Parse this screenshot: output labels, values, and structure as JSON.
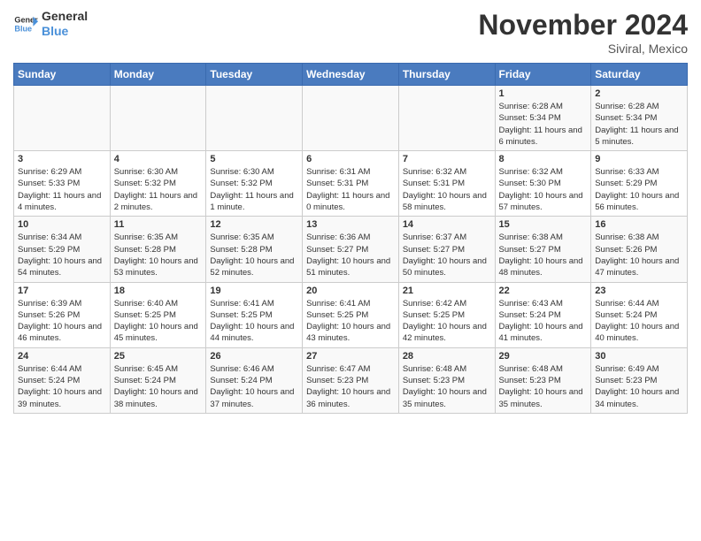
{
  "logo": {
    "line1": "General",
    "line2": "Blue"
  },
  "title": "November 2024",
  "location": "Siviral, Mexico",
  "weekdays": [
    "Sunday",
    "Monday",
    "Tuesday",
    "Wednesday",
    "Thursday",
    "Friday",
    "Saturday"
  ],
  "weeks": [
    [
      {
        "day": "",
        "info": ""
      },
      {
        "day": "",
        "info": ""
      },
      {
        "day": "",
        "info": ""
      },
      {
        "day": "",
        "info": ""
      },
      {
        "day": "",
        "info": ""
      },
      {
        "day": "1",
        "info": "Sunrise: 6:28 AM\nSunset: 5:34 PM\nDaylight: 11 hours and 6 minutes."
      },
      {
        "day": "2",
        "info": "Sunrise: 6:28 AM\nSunset: 5:34 PM\nDaylight: 11 hours and 5 minutes."
      }
    ],
    [
      {
        "day": "3",
        "info": "Sunrise: 6:29 AM\nSunset: 5:33 PM\nDaylight: 11 hours and 4 minutes."
      },
      {
        "day": "4",
        "info": "Sunrise: 6:30 AM\nSunset: 5:32 PM\nDaylight: 11 hours and 2 minutes."
      },
      {
        "day": "5",
        "info": "Sunrise: 6:30 AM\nSunset: 5:32 PM\nDaylight: 11 hours and 1 minute."
      },
      {
        "day": "6",
        "info": "Sunrise: 6:31 AM\nSunset: 5:31 PM\nDaylight: 11 hours and 0 minutes."
      },
      {
        "day": "7",
        "info": "Sunrise: 6:32 AM\nSunset: 5:31 PM\nDaylight: 10 hours and 58 minutes."
      },
      {
        "day": "8",
        "info": "Sunrise: 6:32 AM\nSunset: 5:30 PM\nDaylight: 10 hours and 57 minutes."
      },
      {
        "day": "9",
        "info": "Sunrise: 6:33 AM\nSunset: 5:29 PM\nDaylight: 10 hours and 56 minutes."
      }
    ],
    [
      {
        "day": "10",
        "info": "Sunrise: 6:34 AM\nSunset: 5:29 PM\nDaylight: 10 hours and 54 minutes."
      },
      {
        "day": "11",
        "info": "Sunrise: 6:35 AM\nSunset: 5:28 PM\nDaylight: 10 hours and 53 minutes."
      },
      {
        "day": "12",
        "info": "Sunrise: 6:35 AM\nSunset: 5:28 PM\nDaylight: 10 hours and 52 minutes."
      },
      {
        "day": "13",
        "info": "Sunrise: 6:36 AM\nSunset: 5:27 PM\nDaylight: 10 hours and 51 minutes."
      },
      {
        "day": "14",
        "info": "Sunrise: 6:37 AM\nSunset: 5:27 PM\nDaylight: 10 hours and 50 minutes."
      },
      {
        "day": "15",
        "info": "Sunrise: 6:38 AM\nSunset: 5:27 PM\nDaylight: 10 hours and 48 minutes."
      },
      {
        "day": "16",
        "info": "Sunrise: 6:38 AM\nSunset: 5:26 PM\nDaylight: 10 hours and 47 minutes."
      }
    ],
    [
      {
        "day": "17",
        "info": "Sunrise: 6:39 AM\nSunset: 5:26 PM\nDaylight: 10 hours and 46 minutes."
      },
      {
        "day": "18",
        "info": "Sunrise: 6:40 AM\nSunset: 5:25 PM\nDaylight: 10 hours and 45 minutes."
      },
      {
        "day": "19",
        "info": "Sunrise: 6:41 AM\nSunset: 5:25 PM\nDaylight: 10 hours and 44 minutes."
      },
      {
        "day": "20",
        "info": "Sunrise: 6:41 AM\nSunset: 5:25 PM\nDaylight: 10 hours and 43 minutes."
      },
      {
        "day": "21",
        "info": "Sunrise: 6:42 AM\nSunset: 5:25 PM\nDaylight: 10 hours and 42 minutes."
      },
      {
        "day": "22",
        "info": "Sunrise: 6:43 AM\nSunset: 5:24 PM\nDaylight: 10 hours and 41 minutes."
      },
      {
        "day": "23",
        "info": "Sunrise: 6:44 AM\nSunset: 5:24 PM\nDaylight: 10 hours and 40 minutes."
      }
    ],
    [
      {
        "day": "24",
        "info": "Sunrise: 6:44 AM\nSunset: 5:24 PM\nDaylight: 10 hours and 39 minutes."
      },
      {
        "day": "25",
        "info": "Sunrise: 6:45 AM\nSunset: 5:24 PM\nDaylight: 10 hours and 38 minutes."
      },
      {
        "day": "26",
        "info": "Sunrise: 6:46 AM\nSunset: 5:24 PM\nDaylight: 10 hours and 37 minutes."
      },
      {
        "day": "27",
        "info": "Sunrise: 6:47 AM\nSunset: 5:23 PM\nDaylight: 10 hours and 36 minutes."
      },
      {
        "day": "28",
        "info": "Sunrise: 6:48 AM\nSunset: 5:23 PM\nDaylight: 10 hours and 35 minutes."
      },
      {
        "day": "29",
        "info": "Sunrise: 6:48 AM\nSunset: 5:23 PM\nDaylight: 10 hours and 35 minutes."
      },
      {
        "day": "30",
        "info": "Sunrise: 6:49 AM\nSunset: 5:23 PM\nDaylight: 10 hours and 34 minutes."
      }
    ]
  ]
}
